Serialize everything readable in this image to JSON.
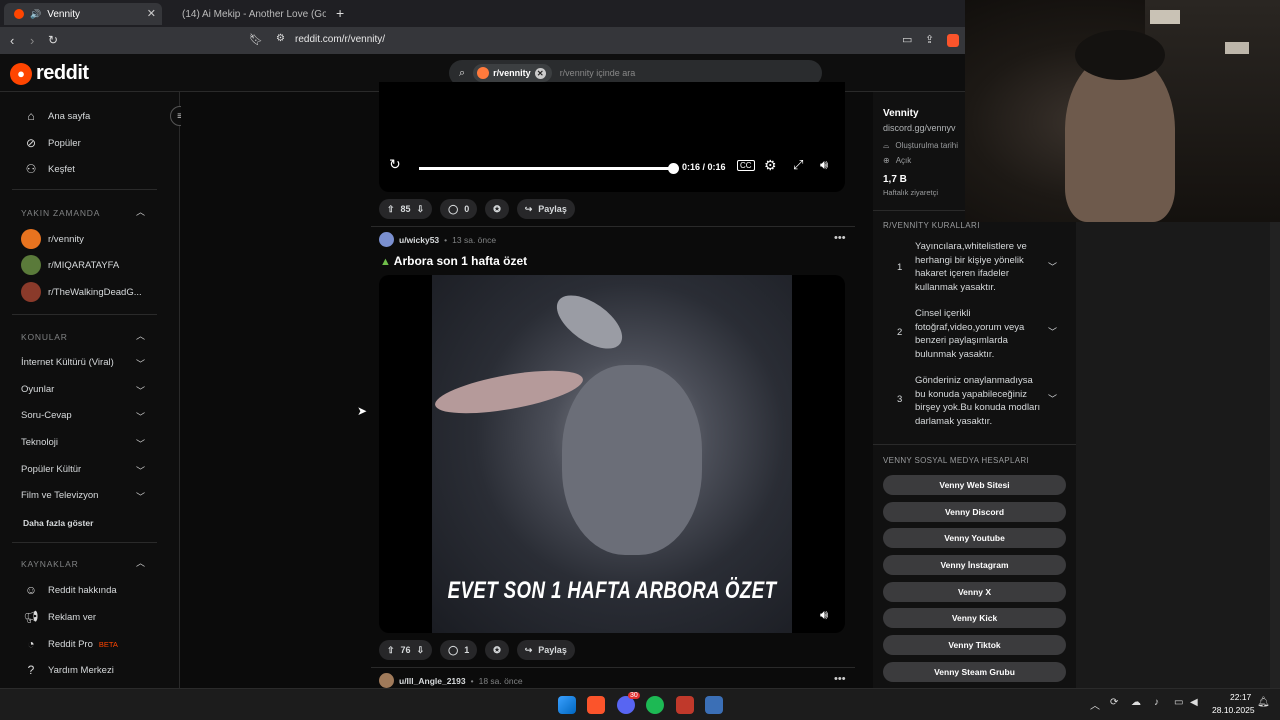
{
  "browser": {
    "tabs": [
      {
        "label": "Vennity",
        "active": true
      },
      {
        "label": "(14) Ai Mekip - Another Love (Gogolii",
        "active": false
      }
    ],
    "new_tab": "+",
    "url": "reddit.com/r/vennity/"
  },
  "header": {
    "logo_text": "reddit",
    "search_chip": "r/vennity",
    "search_placeholder": "r/vennity içinde ara"
  },
  "sidebar": {
    "main_nav": [
      {
        "label": "Ana sayfa",
        "icon": "home-icon"
      },
      {
        "label": "Popüler",
        "icon": "popular-icon"
      },
      {
        "label": "Keşfet",
        "icon": "explore-icon"
      }
    ],
    "recent_heading": "YAKIN ZAMANDA",
    "recent": [
      {
        "label": "r/vennity",
        "color": "#e8731f"
      },
      {
        "label": "r/MIQARATAYFA",
        "color": "#5a7a3a"
      },
      {
        "label": "r/TheWalkingDeadG...",
        "color": "#8a3a2a"
      }
    ],
    "topics_heading": "KONULAR",
    "topics": [
      "İnternet Kültürü (Viral)",
      "Oyunlar",
      "Soru-Cevap",
      "Teknoloji",
      "Popüler Kültür",
      "Film ve Televizyon"
    ],
    "show_more": "Daha fazla göster",
    "resources_heading": "KAYNAKLAR",
    "resources": [
      {
        "label": "Reddit hakkında",
        "icon": "reddit-icon"
      },
      {
        "label": "Reklam ver",
        "icon": "megaphone-icon"
      },
      {
        "label": "Reddit Pro",
        "badge": "BETA",
        "icon": "pro-icon"
      },
      {
        "label": "Yardım Merkezi",
        "icon": "help-icon"
      }
    ]
  },
  "feed": {
    "post1": {
      "time": "0:16 / 0:16",
      "progress": 1.0,
      "upvotes": "85",
      "comments": "0",
      "share": "Paylaş"
    },
    "post2": {
      "author": "u/wicky53",
      "age": "13 sa. önce",
      "title": "Arbora son 1 hafta özet",
      "caption": "EVET SON 1 HAFTA ARBORA ÖZET",
      "upvotes": "76",
      "comments": "1",
      "share": "Paylaş"
    },
    "post3": {
      "author": "u/Ill_Angle_2193",
      "age": "18 sa. önce"
    }
  },
  "right": {
    "name": "Vennity",
    "link": "discord.gg/vennyv",
    "created": "Oluşturulma tarihi",
    "visibility": "Açık",
    "visitors": "1,7 B",
    "visitors_label": "Haftalık ziyaretçi",
    "rules_heading": "R/VENNİTY KURALLARI",
    "rules": [
      {
        "num": "1",
        "text": "Yayıncılara,whitelistlere ve herhangi bir kişiye yönelik hakaret içeren ifadeler kullanmak yasaktır."
      },
      {
        "num": "2",
        "text": "Cinsel içerikli fotoğraf,video,yorum veya benzeri paylaşımlarda bulunmak yasaktır."
      },
      {
        "num": "3",
        "text": "Gönderiniz onaylanmadıysa bu konuda yapabileceğiniz birşey yok.Bu konuda modları darlamak yasaktır."
      }
    ],
    "social_heading": "VENNY SOSYAL MEDYA HESAPLARI",
    "social": [
      "Venny Web Sitesi",
      "Venny Discord",
      "Venny Youtube",
      "Venny İnstagram",
      "Venny X",
      "Venny Kick",
      "Venny Tiktok",
      "Venny Steam Grubu"
    ]
  },
  "taskbar": {
    "time": "22:17",
    "date": "28.10.2025",
    "notif_count": "30"
  },
  "colors": {
    "accent": "#ff4500",
    "bg": "#0b0b0b"
  }
}
